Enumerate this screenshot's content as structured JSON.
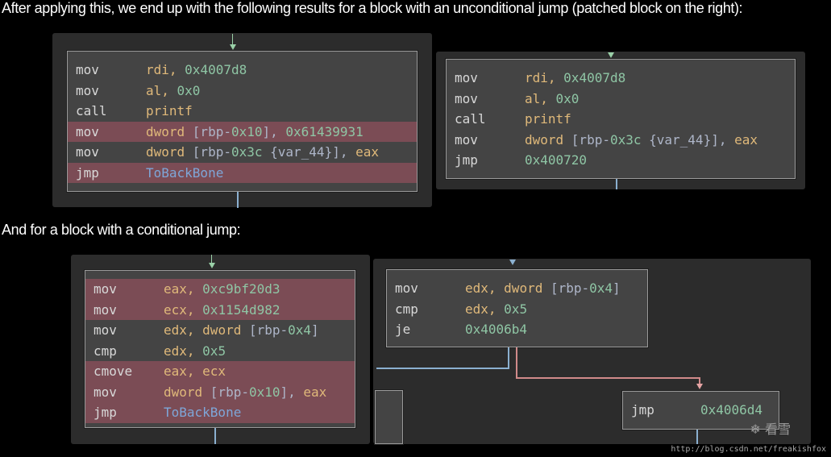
{
  "captions": {
    "unconditional": "After applying this, we end up with the following results for a block with an unconditional jump (patched block on the right):",
    "conditional": "And for a block with a conditional jump:"
  },
  "blocks": {
    "uncond_original": [
      {
        "op": "mov",
        "parts": [
          {
            "t": "rdi, ",
            "c": "fn"
          },
          {
            "t": "0x4007d8",
            "c": "num"
          }
        ],
        "hl": false
      },
      {
        "op": "mov",
        "parts": [
          {
            "t": "al, ",
            "c": "fn"
          },
          {
            "t": "0x0",
            "c": "num"
          }
        ],
        "hl": false
      },
      {
        "op": "call",
        "parts": [
          {
            "t": "printf",
            "c": "fn"
          }
        ],
        "hl": false
      },
      {
        "op": "mov",
        "parts": [
          {
            "t": "dword ",
            "c": "fn"
          },
          {
            "t": "[rbp-",
            "c": "brk"
          },
          {
            "t": "0x10",
            "c": "num"
          },
          {
            "t": "], ",
            "c": "brk"
          },
          {
            "t": "0x61439931",
            "c": "num"
          }
        ],
        "hl": true
      },
      {
        "op": "mov",
        "parts": [
          {
            "t": "dword ",
            "c": "fn"
          },
          {
            "t": "[rbp-",
            "c": "brk"
          },
          {
            "t": "0x3c",
            "c": "num"
          },
          {
            "t": " {var_44}], ",
            "c": "brk"
          },
          {
            "t": "eax",
            "c": "fn"
          }
        ],
        "hl": false
      },
      {
        "op": "jmp",
        "parts": [
          {
            "t": "ToBackBone",
            "c": "lbl"
          }
        ],
        "hl": true
      }
    ],
    "uncond_patched": [
      {
        "op": "mov",
        "parts": [
          {
            "t": "rdi, ",
            "c": "fn"
          },
          {
            "t": "0x4007d8",
            "c": "num"
          }
        ],
        "hl": false
      },
      {
        "op": "mov",
        "parts": [
          {
            "t": "al, ",
            "c": "fn"
          },
          {
            "t": "0x0",
            "c": "num"
          }
        ],
        "hl": false
      },
      {
        "op": "call",
        "parts": [
          {
            "t": "printf",
            "c": "fn"
          }
        ],
        "hl": false
      },
      {
        "op": "mov",
        "parts": [
          {
            "t": "dword ",
            "c": "fn"
          },
          {
            "t": "[rbp-",
            "c": "brk"
          },
          {
            "t": "0x3c",
            "c": "num"
          },
          {
            "t": " {var_44}], ",
            "c": "brk"
          },
          {
            "t": "eax",
            "c": "fn"
          }
        ],
        "hl": false
      },
      {
        "op": "jmp",
        "parts": [
          {
            "t": "0x400720",
            "c": "num"
          }
        ],
        "hl": false
      }
    ],
    "cond_original": [
      {
        "op": "mov",
        "parts": [
          {
            "t": "eax, ",
            "c": "fn"
          },
          {
            "t": "0xc9bf20d3",
            "c": "num"
          }
        ],
        "hl": true
      },
      {
        "op": "mov",
        "parts": [
          {
            "t": "ecx, ",
            "c": "fn"
          },
          {
            "t": "0x1154d982",
            "c": "num"
          }
        ],
        "hl": true
      },
      {
        "op": "mov",
        "parts": [
          {
            "t": "edx, ",
            "c": "fn"
          },
          {
            "t": "dword ",
            "c": "fn"
          },
          {
            "t": "[rbp-",
            "c": "brk"
          },
          {
            "t": "0x4",
            "c": "num"
          },
          {
            "t": "]",
            "c": "brk"
          }
        ],
        "hl": false
      },
      {
        "op": "cmp",
        "parts": [
          {
            "t": "edx, ",
            "c": "fn"
          },
          {
            "t": "0x5",
            "c": "num"
          }
        ],
        "hl": false
      },
      {
        "op": "cmove",
        "parts": [
          {
            "t": "eax, ecx",
            "c": "fn"
          }
        ],
        "hl": true
      },
      {
        "op": "mov",
        "parts": [
          {
            "t": "dword ",
            "c": "fn"
          },
          {
            "t": "[rbp-",
            "c": "brk"
          },
          {
            "t": "0x10",
            "c": "num"
          },
          {
            "t": "], ",
            "c": "brk"
          },
          {
            "t": "eax",
            "c": "fn"
          }
        ],
        "hl": true
      },
      {
        "op": "jmp",
        "parts": [
          {
            "t": "ToBackBone",
            "c": "lbl"
          }
        ],
        "hl": true
      }
    ],
    "cond_patched": [
      {
        "op": "mov",
        "parts": [
          {
            "t": "edx, ",
            "c": "fn"
          },
          {
            "t": "dword ",
            "c": "fn"
          },
          {
            "t": "[rbp-",
            "c": "brk"
          },
          {
            "t": "0x4",
            "c": "num"
          },
          {
            "t": "]",
            "c": "brk"
          }
        ],
        "hl": false
      },
      {
        "op": "cmp",
        "parts": [
          {
            "t": "edx, ",
            "c": "fn"
          },
          {
            "t": "0x5",
            "c": "num"
          }
        ],
        "hl": false
      },
      {
        "op": "je",
        "parts": [
          {
            "t": "0x4006b4",
            "c": "num"
          }
        ],
        "hl": false
      }
    ],
    "cond_target": [
      {
        "op": "jmp",
        "parts": [
          {
            "t": "0x4006d4",
            "c": "num"
          }
        ],
        "hl": false
      }
    ]
  },
  "watermark": {
    "logo_text": "看雪",
    "url": "http://blog.csdn.net/freakishfox"
  }
}
